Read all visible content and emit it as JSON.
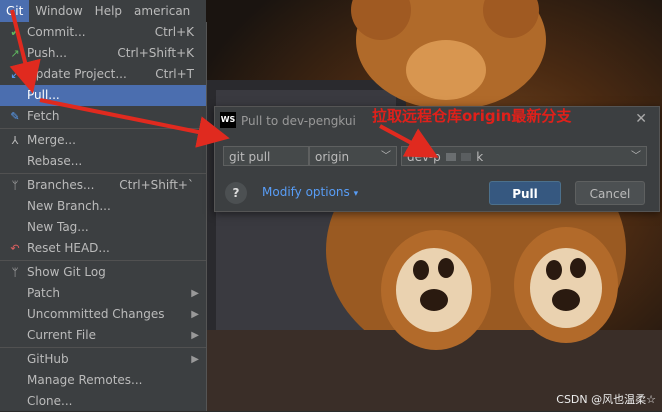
{
  "menubar": {
    "items": [
      "Git",
      "Window",
      "Help",
      "american"
    ]
  },
  "menu": {
    "items": [
      {
        "label": "Commit...",
        "shortcut": "Ctrl+K",
        "icon": "check-icon"
      },
      {
        "label": "Push...",
        "shortcut": "Ctrl+Shift+K",
        "icon": "push-arrow-icon"
      },
      {
        "label": "Update Project...",
        "shortcut": "Ctrl+T",
        "icon": "update-arrow-icon"
      },
      {
        "label": "Pull...",
        "shortcut": "",
        "icon": ""
      },
      {
        "label": "Fetch",
        "shortcut": "",
        "icon": "fetch-icon"
      },
      {
        "label": "Merge...",
        "shortcut": "",
        "icon": "merge-icon"
      },
      {
        "label": "Rebase...",
        "shortcut": "",
        "icon": ""
      },
      {
        "label": "Branches...",
        "shortcut": "Ctrl+Shift+`",
        "icon": "branch-icon"
      },
      {
        "label": "New Branch...",
        "shortcut": "",
        "icon": ""
      },
      {
        "label": "New Tag...",
        "shortcut": "",
        "icon": ""
      },
      {
        "label": "Reset HEAD...",
        "shortcut": "",
        "icon": "reset-icon"
      },
      {
        "label": "Show Git Log",
        "shortcut": "",
        "icon": "git-log-icon"
      },
      {
        "label": "Patch",
        "shortcut": "",
        "icon": ""
      },
      {
        "label": "Uncommitted Changes",
        "shortcut": "",
        "icon": ""
      },
      {
        "label": "Current File",
        "shortcut": "",
        "icon": ""
      },
      {
        "label": "GitHub",
        "shortcut": "",
        "icon": ""
      },
      {
        "label": "Manage Remotes...",
        "shortcut": "",
        "icon": ""
      },
      {
        "label": "Clone...",
        "shortcut": "",
        "icon": ""
      }
    ]
  },
  "dialog": {
    "logo": "WS",
    "title": "Pull to dev-pengkui",
    "command": "git pull",
    "remote": "origin",
    "branch": "dev-p",
    "branch_tail": "k",
    "modify_options": "Modify options",
    "help": "?",
    "pull_label": "Pull",
    "cancel_label": "Cancel"
  },
  "annotation": "拉取远程仓库origin最新分支",
  "watermark": "CSDN @风也温柔☆",
  "colors": {
    "accent": "#4b6eaf",
    "annotation": "#e0201a",
    "link": "#589df6"
  }
}
